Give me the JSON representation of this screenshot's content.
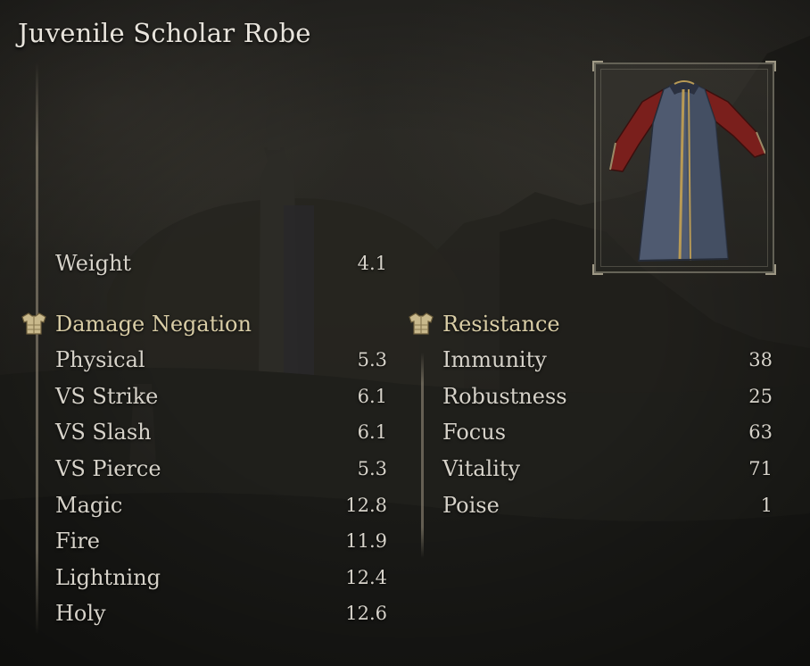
{
  "item": {
    "name": "Juvenile Scholar Robe",
    "image_icon": "robe-icon"
  },
  "weight": {
    "label": "Weight",
    "value": "4.1"
  },
  "damage_negation": {
    "header": "Damage Negation",
    "icon": "armor-icon",
    "stats": [
      {
        "label": "Physical",
        "value": "5.3"
      },
      {
        "label": "VS Strike",
        "value": "6.1"
      },
      {
        "label": "VS Slash",
        "value": "6.1"
      },
      {
        "label": "VS Pierce",
        "value": "5.3"
      },
      {
        "label": "Magic",
        "value": "12.8"
      },
      {
        "label": "Fire",
        "value": "11.9"
      },
      {
        "label": "Lightning",
        "value": "12.4"
      },
      {
        "label": "Holy",
        "value": "12.6"
      }
    ]
  },
  "resistance": {
    "header": "Resistance",
    "icon": "armor-icon",
    "stats": [
      {
        "label": "Immunity",
        "value": "38"
      },
      {
        "label": "Robustness",
        "value": "25"
      },
      {
        "label": "Focus",
        "value": "63"
      },
      {
        "label": "Vitality",
        "value": "71"
      },
      {
        "label": "Poise",
        "value": "1"
      }
    ]
  },
  "colors": {
    "header_gold": "#d9cda6",
    "text": "#d6d2c9",
    "robe_blue": "#4f5a70",
    "robe_red": "#7a1f1c",
    "trim_gold": "#b89a55"
  }
}
